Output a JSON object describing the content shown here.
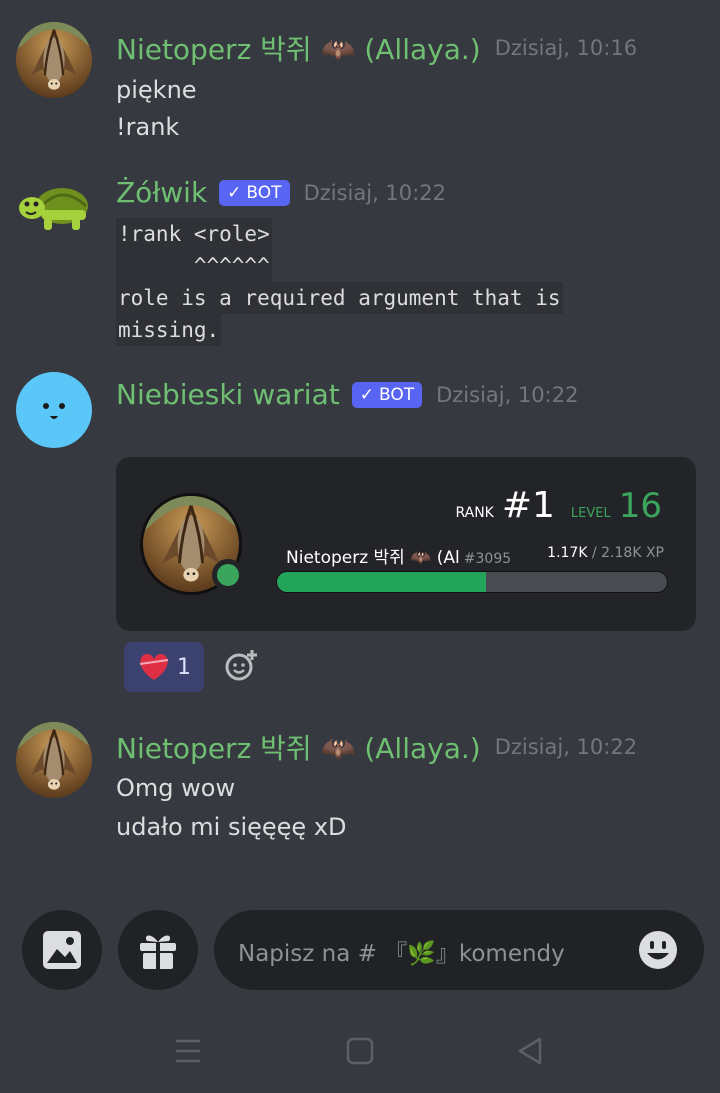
{
  "messages": [
    {
      "author": "Nietoperz 박쥐 🦇 (Allaya.)",
      "timestamp": "Dzisiaj, 10:16",
      "lines": [
        "piękne",
        "!rank"
      ]
    },
    {
      "author": "Żółwik",
      "badge": "BOT",
      "timestamp": "Dzisiaj, 10:22",
      "code_lines": [
        "!rank <role>",
        "      ^^^^^^",
        "role is a required argument that is",
        "missing."
      ]
    },
    {
      "author": "Niebieski wariat",
      "badge": "BOT",
      "timestamp": "Dzisiaj, 10:22",
      "rank_card": {
        "rank_label": "RANK",
        "rank_value": "#1",
        "level_label": "LEVEL",
        "level_value": "16",
        "username": "Nietoperz 박쥐 🦇 (Al",
        "discriminator": "#3095",
        "xp_current": "1.17K",
        "xp_max": "/ 2.18K XP",
        "progress": 0.537
      },
      "reaction": {
        "emoji": "heart-icon",
        "count": "1"
      }
    },
    {
      "author": "Nietoperz 박쥐 🦇 (Allaya.)",
      "timestamp": "Dzisiaj, 10:22",
      "lines": [
        "Omg wow",
        "udało mi sięęęę xD"
      ]
    }
  ],
  "composer": {
    "placeholder": "Napisz na # 『🌿』komendy"
  },
  "colors": {
    "background": "#36393f",
    "author_name": "#6fbf73",
    "bot_badge": "#5865f2",
    "progress_fill": "#22a55a"
  }
}
